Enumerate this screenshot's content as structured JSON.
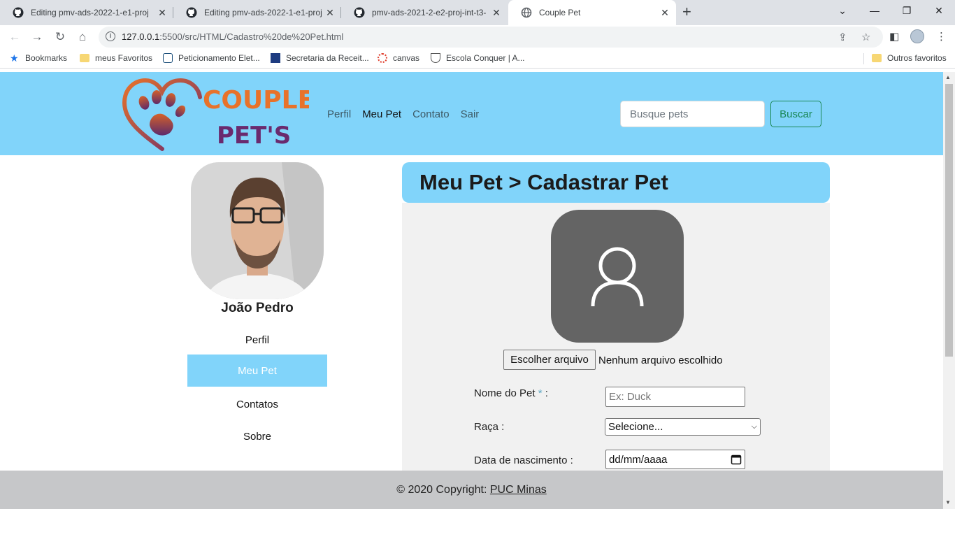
{
  "browser": {
    "tabs": [
      {
        "title": "Editing pmv-ads-2022-1-e1-proj",
        "icon": "github-icon"
      },
      {
        "title": "Editing pmv-ads-2022-1-e1-proj",
        "icon": "github-icon"
      },
      {
        "title": "pmv-ads-2021-2-e2-proj-int-t3-",
        "icon": "github-icon"
      },
      {
        "title": "Couple Pet",
        "icon": "globe-icon"
      }
    ],
    "url_host": "127.0.0.1",
    "url_path": ":5500/src/HTML/Cadastro%20de%20Pet.html",
    "bookmarks": [
      {
        "label": "Bookmarks",
        "icon": "star-icon"
      },
      {
        "label": "meus Favoritos",
        "icon": "folder-icon"
      },
      {
        "label": "Peticionamento Elet...",
        "icon": "pje-icon"
      },
      {
        "label": "Secretaria da Receit...",
        "icon": "receita-icon"
      },
      {
        "label": "canvas",
        "icon": "canvas-icon"
      },
      {
        "label": "Escola Conquer | A...",
        "icon": "conquer-icon"
      }
    ],
    "other_bookmarks": "Outros favoritos"
  },
  "header": {
    "logo_text_1": "COUPLE",
    "logo_text_2": "PET'S",
    "nav": [
      "Perfil",
      "Meu Pet",
      "Contato",
      "Sair"
    ],
    "active_nav": "Meu Pet",
    "search_placeholder": "Busque pets",
    "search_button": "Buscar",
    "colors": {
      "header_bg": "#81d4fa",
      "search_btn": "#198754"
    }
  },
  "sidebar": {
    "user_name": "João Pedro",
    "items": [
      "Perfil",
      "Meu Pet",
      "Contatos",
      "Sobre"
    ],
    "active_item": "Meu Pet"
  },
  "form": {
    "heading": "Meu Pet > Cadastrar Pet",
    "file_button": "Escolher arquivo",
    "file_status": "Nenhum arquivo escolhido",
    "pet_name_label": "Nome do Pet",
    "required_mark": "*",
    "label_suffix": " :",
    "pet_name_placeholder": "Ex: Duck",
    "breed_label": "Raça :",
    "breed_selected": "Selecione...",
    "birth_label": "Data de nascimento :",
    "birth_placeholder": "dd/mm/aaaa"
  },
  "footer": {
    "copyright": "© 2020 Copyright: ",
    "link": "PUC Minas"
  }
}
